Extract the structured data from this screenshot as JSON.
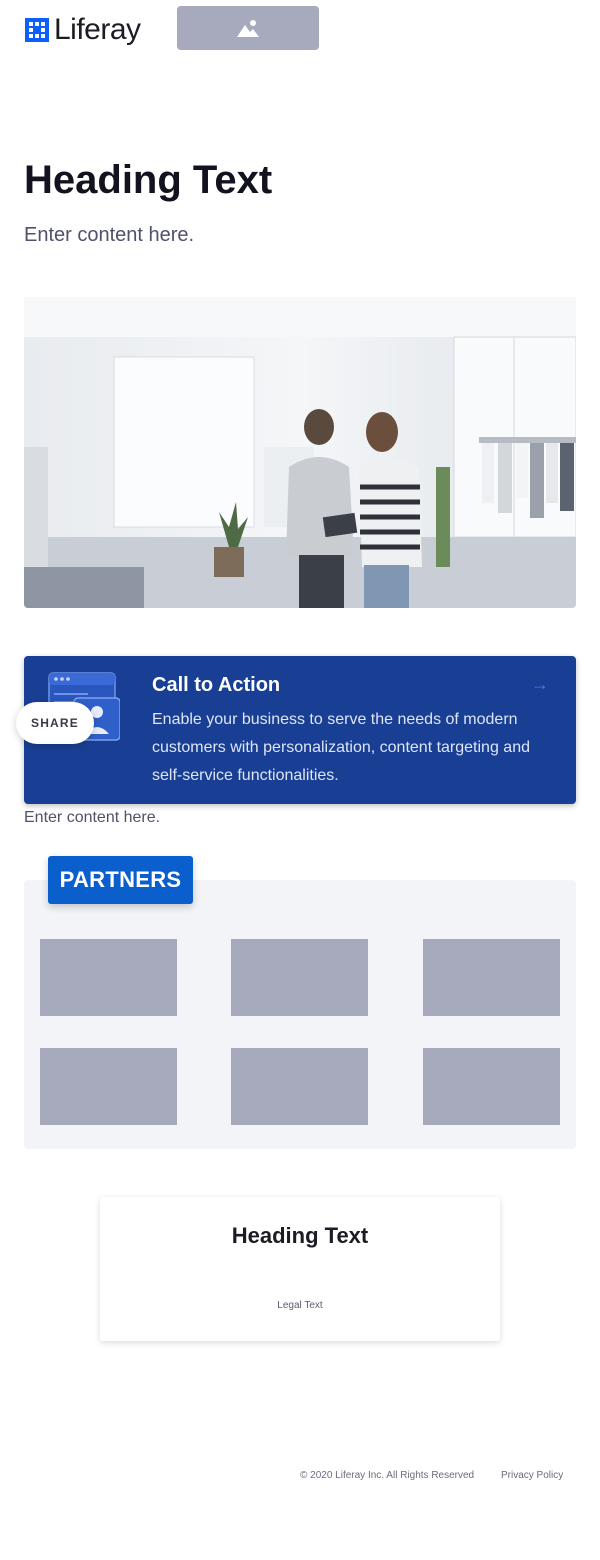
{
  "header": {
    "logo_text": "Liferay",
    "image_placeholder_icon": "image-icon"
  },
  "hero": {
    "title": "Heading Text",
    "body": "Enter content here."
  },
  "photo": {
    "icon": "store-photo"
  },
  "cta": {
    "title": "Call to Action",
    "text": "Enable your business to serve the needs of modern customers with personalization, content targeting and self-service functionalities.",
    "arrow": "→",
    "icon": "browser-user-icon"
  },
  "share": {
    "label": "SHARE"
  },
  "after_cta": {
    "text": "Enter content here."
  },
  "partners": {
    "label": "PARTNERS",
    "logo_count": 6
  },
  "card": {
    "title": "Heading Text",
    "legal": "Legal Text"
  },
  "footer": {
    "copyright": "© 2020 Liferay Inc. All Rights Reserved",
    "privacy": "Privacy Policy"
  },
  "colors": {
    "accent": "#0b5fff",
    "cta_bg": "#183f94",
    "placeholder": "#a7a9bc",
    "panel_bg": "#f3f4f8"
  }
}
